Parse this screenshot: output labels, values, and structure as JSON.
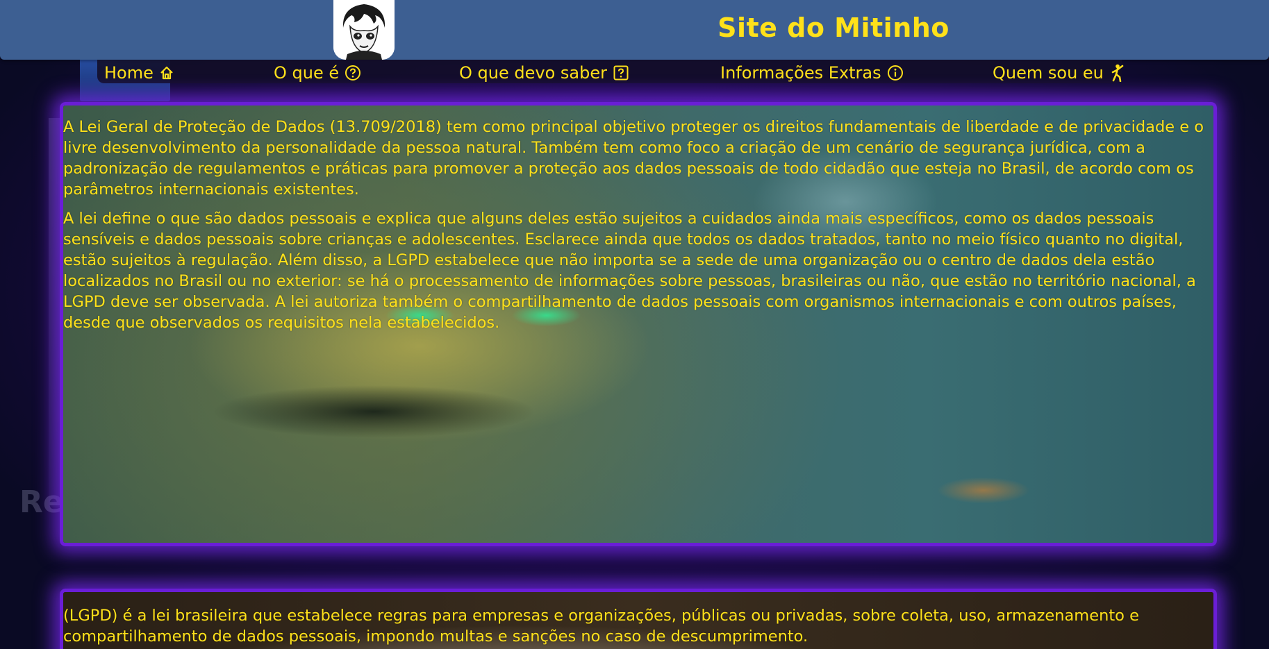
{
  "header": {
    "site_title": "Site do Mitinho",
    "avatar_alt": "anime avatar"
  },
  "nav": {
    "items": [
      {
        "label": "Home",
        "icon": "home-icon"
      },
      {
        "label": "O que é",
        "icon": "question-circle-icon"
      },
      {
        "label": "O que devo saber",
        "icon": "question-square-icon"
      },
      {
        "label": "Informações Extras",
        "icon": "info-circle-icon"
      },
      {
        "label": "Quem sou eu",
        "icon": "person-kick-icon"
      }
    ]
  },
  "main": {
    "panel1": {
      "paragraphs": [
        "A Lei Geral de Proteção de Dados (13.709/2018) tem como principal objetivo proteger os direitos fundamentais de liberdade e de privacidade e o livre desenvolvimento da personalidade da pessoa natural. Também tem como foco a criação de um cenário de segurança jurídica, com a padronização de regulamentos e práticas para promover a proteção aos dados pessoais de todo cidadão que esteja no Brasil, de acordo com os parâmetros internacionais existentes.",
        "A lei define o que são dados pessoais e explica que alguns deles estão sujeitos a cuidados ainda mais específicos, como os dados pessoais sensíveis e dados pessoais sobre crianças e adolescentes. Esclarece ainda que todos os dados tratados, tanto no meio físico quanto no digital, estão sujeitos à regulação. Além disso, a LGPD estabelece que não importa se a sede de uma organização ou o centro de dados dela estão localizados no Brasil ou no exterior: se há o processamento de informações sobre pessoas, brasileiras ou não, que estão no território nacional, a LGPD deve ser observada. A lei autoriza também o compartilhamento de dados pessoais com organismos internacionais e com outros países, desde que observados os requisitos nela estabelecidos."
      ]
    },
    "panel2": {
      "paragraphs": [
        "(LGPD) é a lei brasileira que estabelece regras para empresas e organizações, públicas ou privadas, sobre coleta, uso, armazenamento e compartilhamento de dados pessoais, impondo multas e sanções no caso de descumprimento."
      ]
    }
  },
  "background": {
    "deco_text": "Re"
  },
  "colors": {
    "accent_text": "#ffe11a",
    "header_bg": "#3d5f92",
    "panel_border": "#6a1ed6",
    "page_bg": "#1a0a45"
  }
}
